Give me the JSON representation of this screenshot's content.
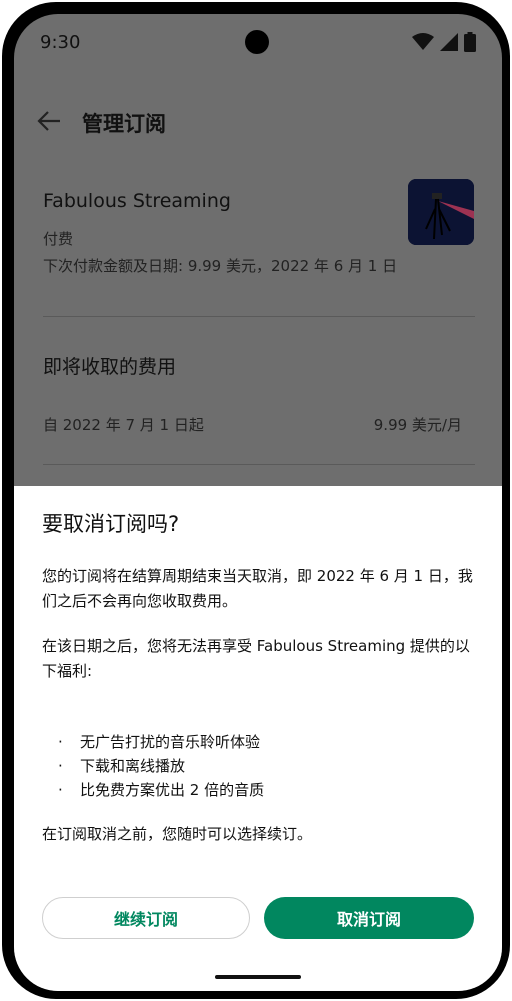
{
  "status_bar": {
    "time": "9:30"
  },
  "app_bar": {
    "title": "管理订阅"
  },
  "subscription": {
    "name": "Fabulous Streaming",
    "status": "付费",
    "next_payment": "下次付款金额及日期: 9.99 美元，2022 年 6 月 1 日"
  },
  "upcoming_charges": {
    "title": "即将收取的费用",
    "date_label": "自 2022 年 7 月 1 日起",
    "amount": "9.99 美元/月"
  },
  "dialog": {
    "title": "要取消订阅吗?",
    "para1": "您的订阅将在结算周期结束当天取消，即 2022 年 6 月 1 日，我们之后不会再向您收取费用。",
    "para2": "在该日期之后，您将无法再享受 Fabulous Streaming 提供的以下福利:",
    "benefits": [
      "无广告打扰的音乐聆听体验",
      "下载和离线播放",
      "比免费方案优出 2 倍的音质"
    ],
    "bullet": "·",
    "para3": "在订阅取消之前，您随时可以选择续订。",
    "continue_label": "继续订阅",
    "cancel_label": "取消订阅"
  },
  "colors": {
    "accent": "#01875f",
    "scrim": "#6e6e6e"
  }
}
